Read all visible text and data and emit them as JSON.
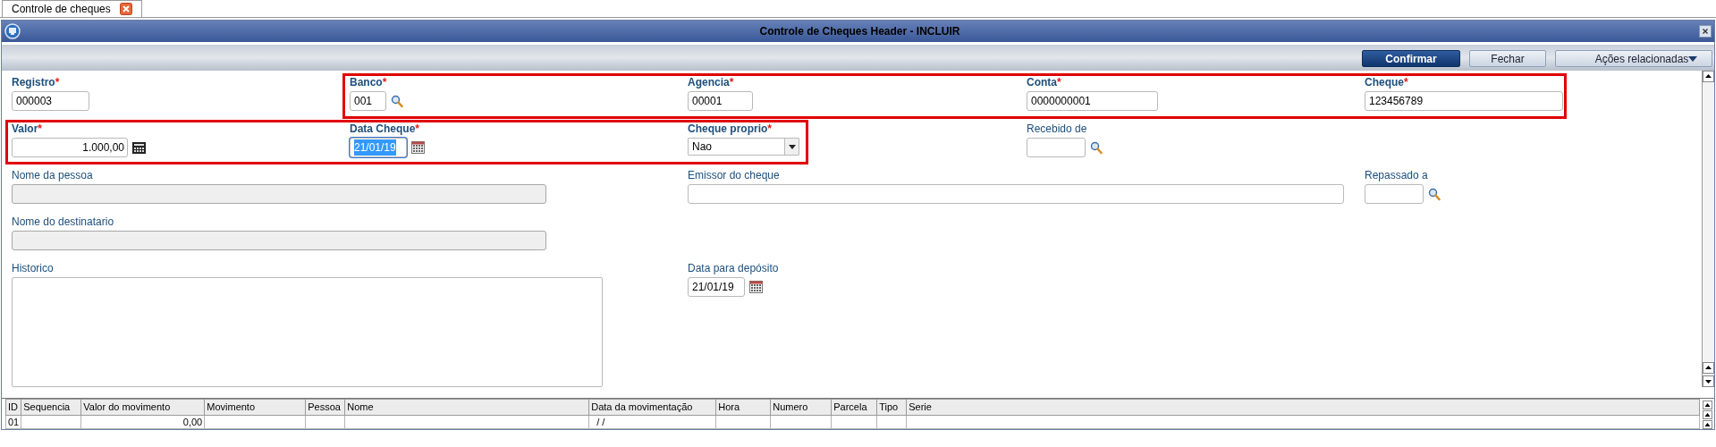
{
  "tab": {
    "label": "Controle de cheques",
    "selected": true
  },
  "window": {
    "title": "Controle de Cheques Header - INCLUIR"
  },
  "toolbar": {
    "buttons": [
      {
        "label": "Confirmar",
        "primary": true
      },
      {
        "label": "Fechar",
        "primary": false
      },
      {
        "label": "Ações relacionadas",
        "primary": false
      }
    ]
  },
  "form": {
    "registro": {
      "label": "Registro",
      "required_mark": "*",
      "kind": "text",
      "value": "000003",
      "disabled": false,
      "focused": false
    },
    "banco": {
      "label": "Banco",
      "required_mark": "*",
      "kind": "lookup",
      "value": "001",
      "disabled": false,
      "focused": false
    },
    "agencia": {
      "label": "Agencia",
      "required_mark": "*",
      "kind": "text",
      "value": "00001",
      "disabled": false,
      "focused": false
    },
    "conta": {
      "label": "Conta",
      "required_mark": "*",
      "kind": "text",
      "value": "0000000001",
      "disabled": false,
      "focused": false
    },
    "cheque": {
      "label": "Cheque",
      "required_mark": "*",
      "kind": "text",
      "value": "123456789",
      "disabled": false,
      "focused": false
    },
    "valor": {
      "label": "Valor",
      "required_mark": "*",
      "kind": "calculator",
      "value": "1.000,00",
      "disabled": false,
      "focused": false
    },
    "data_cheque": {
      "label": "Data Cheque",
      "required_mark": "*",
      "kind": "date",
      "value": "21/01/19",
      "disabled": false,
      "focused": true
    },
    "cheque_proprio": {
      "label": "Cheque proprio",
      "required_mark": "*",
      "kind": "select",
      "value": "Nao",
      "disabled": false,
      "focused": false
    },
    "recebido_de": {
      "label": "Recebido de",
      "kind": "lookup",
      "disabled": false,
      "focused": false
    },
    "nome_da_pessoa": {
      "label": "Nome da pessoa",
      "kind": "text",
      "disabled": true,
      "focused": false
    },
    "emissor_do_cheque": {
      "label": "Emissor do cheque",
      "kind": "text",
      "disabled": false,
      "focused": false
    },
    "repassado_a": {
      "label": "Repassado a",
      "kind": "lookup",
      "disabled": false,
      "focused": false
    },
    "nome_do_destinatario": {
      "label": "Nome do destinatario",
      "kind": "text",
      "disabled": true,
      "focused": false
    },
    "historico": {
      "label": "Historico",
      "kind": "textarea",
      "disabled": false,
      "focused": false
    },
    "data_para_deposito": {
      "label": "Data para depósito",
      "kind": "date",
      "value": "21/01/19",
      "disabled": false,
      "focused": false
    }
  },
  "table": {
    "columns": [
      "ID",
      "Sequencia",
      "Valor do movimento",
      "Movimento",
      "Pessoa",
      "Nome",
      "Data da movimentação",
      "Hora",
      "Numero",
      "Parcela",
      "Tipo",
      "Serie"
    ],
    "rows": [
      [
        "01",
        null,
        "0,00",
        null,
        null,
        null,
        "/ /",
        null,
        null,
        null,
        null,
        null
      ]
    ]
  }
}
